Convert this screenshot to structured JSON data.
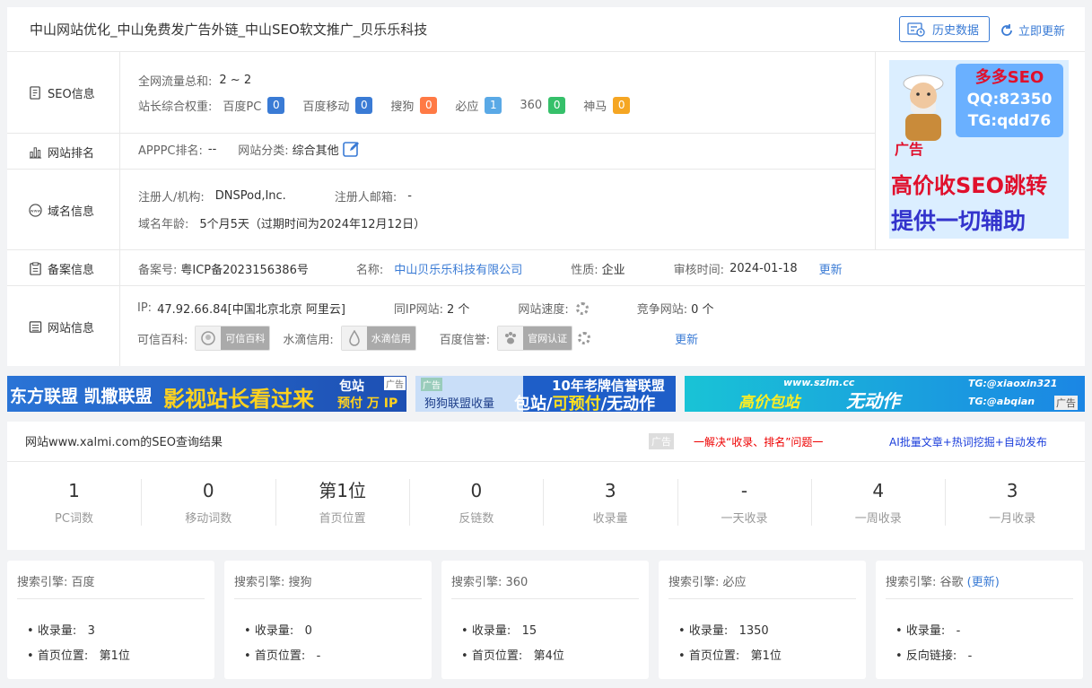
{
  "header": {
    "title": "中山网站优化_中山免费发广告外链_中山SEO软文推广_贝乐乐科技",
    "history_btn": "历史数据",
    "update_btn": "立即更新"
  },
  "seo_info": {
    "label": "SEO信息",
    "traffic_label": "全网流量总和:",
    "traffic_value": "2 ~ 2",
    "weight_label": "站长综合权重:",
    "weights": [
      {
        "name": "百度PC",
        "value": "0",
        "color": "#3a7bd5"
      },
      {
        "name": "百度移动",
        "value": "0",
        "color": "#3a7bd5"
      },
      {
        "name": "搜狗",
        "value": "0",
        "color": "#ff7a45"
      },
      {
        "name": "必应",
        "value": "1",
        "color": "#5aa9e6"
      },
      {
        "name": "360",
        "value": "0",
        "color": "#36c06a"
      },
      {
        "name": "神马",
        "value": "0",
        "color": "#f5a623"
      }
    ]
  },
  "rank_info": {
    "label": "网站排名",
    "apppc_label": "APPPC排名:",
    "apppc_value": "--",
    "category_label": "网站分类:",
    "category_value": "综合其他"
  },
  "domain_info": {
    "label": "域名信息",
    "registrant_label": "注册人/机构:",
    "registrant_value": "DNSPod,Inc.",
    "email_label": "注册人邮箱:",
    "email_value": "-",
    "age_label": "域名年龄:",
    "age_value": "5个月5天（过期时间为2024年12月12日）"
  },
  "icp_info": {
    "label": "备案信息",
    "icp_label": "备案号:",
    "icp_value": "粤ICP备2023156386号",
    "name_label": "名称:",
    "name_value": "中山贝乐乐科技有限公司",
    "nature_label": "性质:",
    "nature_value": "企业",
    "audit_label": "审核时间:",
    "audit_value": "2024-01-18",
    "update_link": "更新"
  },
  "site_info": {
    "label": "网站信息",
    "ip_label": "IP:",
    "ip_value": "47.92.66.84[中国北京北京 阿里云]",
    "same_ip_label": "同IP网站:",
    "same_ip_value": "2 个",
    "speed_label": "网站速度:",
    "competitor_label": "竞争网站:",
    "competitor_value": "0 个",
    "trust_label": "可信百科:",
    "trust_badge": "可信百科",
    "water_label": "水滴信用:",
    "water_badge": "水滴信用",
    "baidu_label": "百度信誉:",
    "baidu_badge": "官网认证",
    "update_link": "更新"
  },
  "ad_side": {
    "line1": "多多SEO",
    "line2": "QQ:82350",
    "line3": "TG:qdd76",
    "tag": "广告",
    "big1": "高价收SEO跳转",
    "big2": "提供一切辅助"
  },
  "banners": {
    "b1_text": "东方联盟 凯撒联盟",
    "b1_big": "影视站长看过来",
    "b1_side1": "包站",
    "b1_side2": "预付 万 IP",
    "b1_tag": "广告",
    "b2_tag": "广告",
    "b2_top": "10年老牌信誉联盟",
    "b2_left": "狗狗联盟收量",
    "b2_main1": "包站/",
    "b2_main2": "可预付",
    "b2_main3": "/无动作",
    "b3_url": "www.szlm.cc",
    "b3_left": "高价包站",
    "b3_mid": "无动作",
    "b3_tg1": "TG:@xiaoxin321",
    "b3_tg2": "TG:@abqian",
    "b3_tag": "广告"
  },
  "result": {
    "title": "网站www.xalmi.com的SEO查询结果",
    "ad_tag": "广告",
    "ad_red": "一解决“收录、排名”问题一",
    "ad_blue": "AI批量文章+热词挖掘+自动发布"
  },
  "stats": [
    {
      "value": "1",
      "label": "PC词数"
    },
    {
      "value": "0",
      "label": "移动词数"
    },
    {
      "value": "第1位",
      "label": "首页位置"
    },
    {
      "value": "0",
      "label": "反链数"
    },
    {
      "value": "3",
      "label": "收录量"
    },
    {
      "value": "-",
      "label": "一天收录"
    },
    {
      "value": "4",
      "label": "一周收录"
    },
    {
      "value": "3",
      "label": "一月收录"
    }
  ],
  "engines": [
    {
      "title": "搜索引擎: 百度",
      "r1_label": "收录量:",
      "r1_value": "3",
      "r2_label": "首页位置:",
      "r2_value": "第1位"
    },
    {
      "title": "搜索引擎: 搜狗",
      "r1_label": "收录量:",
      "r1_value": "0",
      "r2_label": "首页位置:",
      "r2_value": "-"
    },
    {
      "title": "搜索引擎: 360",
      "r1_label": "收录量:",
      "r1_value": "15",
      "r2_label": "首页位置:",
      "r2_value": "第4位"
    },
    {
      "title": "搜索引擎: 必应",
      "r1_label": "收录量:",
      "r1_value": "1350",
      "r2_label": "首页位置:",
      "r2_value": "第1位"
    },
    {
      "title": "搜索引擎: 谷歌",
      "update": "(更新)",
      "r1_label": "收录量:",
      "r1_value": "-",
      "r2_label": "反向链接:",
      "r2_value": "-"
    }
  ]
}
